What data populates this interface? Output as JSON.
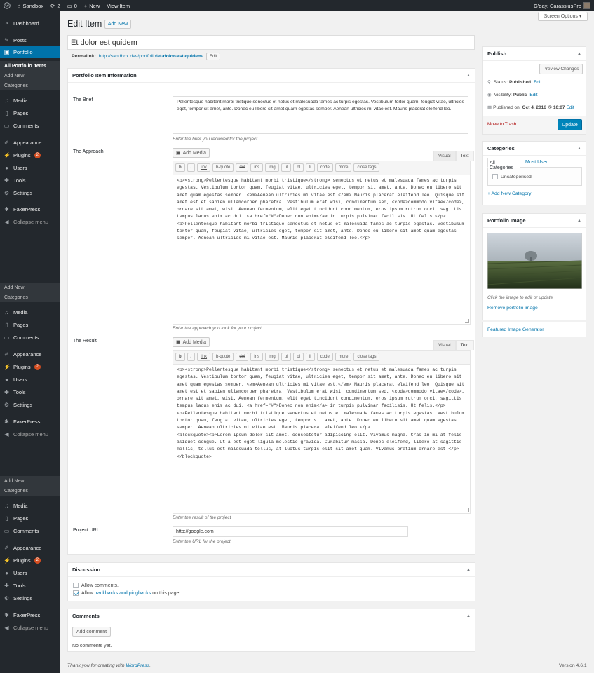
{
  "admin_bar": {
    "site_name": "Sandbox",
    "updates_count": "2",
    "comments_count": "0",
    "new_label": "New",
    "view_label": "View Item",
    "greeting": "G'day, CarassiusPro"
  },
  "sidebar": {
    "dashboard": "Dashboard",
    "posts": "Posts",
    "portfolio": "Portfolio",
    "portfolio_items": "All Portfolio Items",
    "add_new": "Add New",
    "categories": "Categories",
    "media": "Media",
    "pages": "Pages",
    "comments": "Comments",
    "appearance": "Appearance",
    "plugins": "Plugins",
    "plugins_badge": "2",
    "users": "Users",
    "tools": "Tools",
    "settings": "Settings",
    "fakerpress": "FakerPress",
    "collapse": "Collapse menu"
  },
  "header": {
    "title": "Edit Item",
    "add_new": "Add New",
    "screen_options": "Screen Options ▾"
  },
  "post": {
    "title": "Et dolor est quidem",
    "permalink_label": "Permalink:",
    "permalink_base": "http://sandbox.dev/portfolio/",
    "permalink_slug": "et-dolor-est-quidem",
    "permalink_end": "/",
    "edit_label": "Edit"
  },
  "portfolio_info": {
    "title": "Portfolio Item Information",
    "brief_label": "The Brief",
    "brief_text": "Pellentesque habitant morbi tristique senectus et netus et malesuada fames ac turpis egestas. Vestibulum tortor quam, feugiat vitae, ultricies eget, tempor sit amet, ante. Donec eu libero sit amet quam egestas semper. Aenean ultricies mi vitae est. Mauris placerat eleifend leo.",
    "brief_hint": "Enter the brief you recieved for the project",
    "approach_label": "The Approach",
    "approach_hint": "Enter the approach you took for your project",
    "approach_code": "<p><strong>Pellentesque habitant morbi tristique</strong> senectus et netus et malesuada fames ac turpis egestas. Vestibulum tortor quam, feugiat vitae, ultricies eget, tempor sit amet, ante. Donec eu libero sit amet quam egestas semper. <em>Aenean ultricies mi vitae est.</em> Mauris placerat eleifend leo. Quisque sit amet est et sapien ullamcorper pharetra. Vestibulum erat wisi, condimentum sed, <code>commodo vitae</code>, ornare sit amet, wisi. Aenean fermentum, elit eget tincidunt condimentum, eros ipsum rutrum orci, sagittis tempus lacus enim ac dui. <a href=\"#\">Donec non enim</a> in turpis pulvinar facilisis. Ut felis.</p>\n<p>Pellentesque habitant morbi tristique senectus et netus et malesuada fames ac turpis egestas. Vestibulum tortor quam, feugiat vitae, ultricies eget, tempor sit amet, ante. Donec eu libero sit amet quam egestas semper. Aenean ultricies mi vitae est. Mauris placerat eleifend leo.</p>",
    "result_label": "The Result",
    "result_hint": "Enter the result of the project",
    "result_code": "<p><strong>Pellentesque habitant morbi tristique</strong> senectus et netus et malesuada fames ac turpis egestas. Vestibulum tortor quam, feugiat vitae, ultricies eget, tempor sit amet, ante. Donec eu libero sit amet quam egestas semper. <em>Aenean ultricies mi vitae est.</em> Mauris placerat eleifend leo. Quisque sit amet est et sapien ullamcorper pharetra. Vestibulum erat wisi, condimentum sed, <code>commodo vitae</code>, ornare sit amet, wisi. Aenean fermentum, elit eget tincidunt condimentum, eros ipsum rutrum orci, sagittis tempus lacus enim ac dui. <a href=\"#\">Donec non enim</a> in turpis pulvinar facilisis. Ut felis.</p>\n<p>Pellentesque habitant morbi tristique senectus et netus et malesuada fames ac turpis egestas. Vestibulum tortor quam, feugiat vitae, ultricies eget, tempor sit amet, ante. Donec eu libero sit amet quam egestas semper. Aenean ultricies mi vitae est. Mauris placerat eleifend leo.</p>\n<blockquote><p>Lorem ipsum dolor sit amet, consectetur adipiscing elit. Vivamus magna. Cras in mi at felis aliquet congue. Ut a est eget ligula molestie gravida. Curabitur massa. Donec eleifend, libero at sagittis mollis, tellus est malesuada tellus, at luctus turpis elit sit amet quam. Vivamus pretium ornare est.</p>\n</blockquote>",
    "project_url_label": "Project URL",
    "project_url_value": "http://google.com",
    "project_url_hint": "Enter the URL for the project"
  },
  "editor": {
    "add_media": "Add Media",
    "visual": "Visual",
    "text": "Text",
    "qt_buttons": [
      "b",
      "i",
      "link",
      "b-quote",
      "del",
      "ins",
      "img",
      "ul",
      "ol",
      "li",
      "code",
      "more",
      "close tags"
    ]
  },
  "discussion": {
    "title": "Discussion",
    "allow_comments": "Allow comments.",
    "allow_prefix": "Allow",
    "trackbacks_link": "trackbacks and pingbacks",
    "allow_suffix": "on this page."
  },
  "comments_box": {
    "title": "Comments",
    "add_comment": "Add comment",
    "none": "No comments yet."
  },
  "publish": {
    "title": "Publish",
    "preview": "Preview Changes",
    "status_label": "Status:",
    "status_value": "Published",
    "visibility_label": "Visibility:",
    "visibility_value": "Public",
    "published_on_label": "Published on:",
    "published_on_value": "Oct 4, 2016 @ 10:07",
    "edit": "Edit",
    "trash": "Move to Trash",
    "update": "Update"
  },
  "categories_box": {
    "title": "Categories",
    "tab_all": "All Categories",
    "tab_most_used": "Most Used",
    "item": "Uncategorised",
    "add_new": "+ Add New Category"
  },
  "portfolio_image": {
    "title": "Portfolio Image",
    "hint": "Click the image to edit or update",
    "remove": "Remove portfolio image",
    "generator": "Featured Image Generator"
  },
  "footer": {
    "thanks_prefix": "Thank you for creating with",
    "thanks_link": "WordPress",
    "thanks_suffix": ".",
    "version": "Version 4.6.1"
  }
}
